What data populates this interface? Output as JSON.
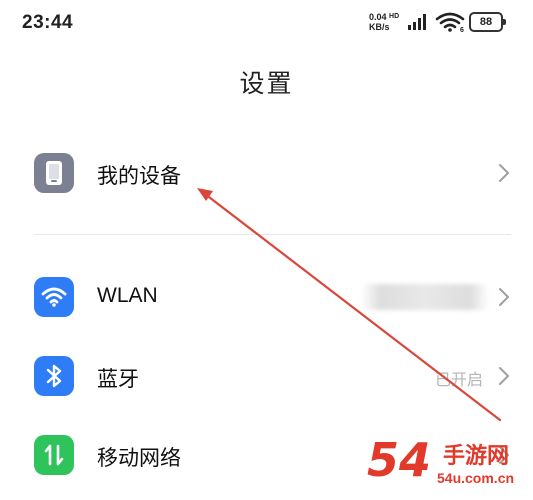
{
  "status": {
    "time": "23:44",
    "net_speed_value": "0.04",
    "net_speed_unit": "KB/s",
    "net_badge": "HD",
    "battery": "88"
  },
  "page": {
    "title": "设置"
  },
  "rows": [
    {
      "label": "我的设备",
      "icon": "device-icon",
      "value": ""
    },
    {
      "label": "WLAN",
      "icon": "wifi-icon",
      "value": ""
    },
    {
      "label": "蓝牙",
      "icon": "bluetooth-icon",
      "value": "已开启"
    },
    {
      "label": "移动网络",
      "icon": "mobile-network-icon",
      "value": ""
    }
  ],
  "colors": {
    "device_icon_bg": "#7b8193",
    "wifi_icon_bg": "#2f7df6",
    "bluetooth_icon_bg": "#2f7df6",
    "mobile_icon_bg": "#2ec45b",
    "annotation_arrow": "#d9473b",
    "watermark": "#e23a2a"
  },
  "watermark": {
    "number": "54",
    "name": "手游网",
    "url": "54u.com.cn"
  }
}
